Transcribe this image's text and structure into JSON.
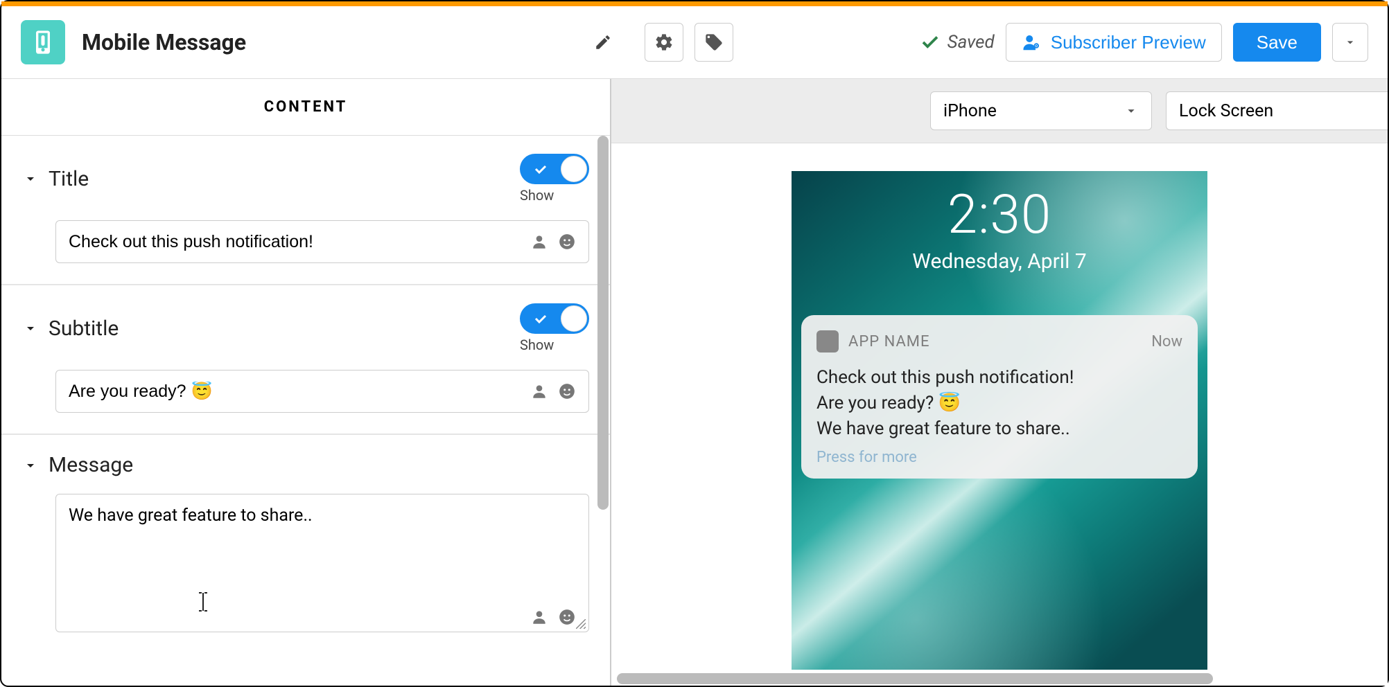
{
  "header": {
    "title": "Mobile Message",
    "saved_label": "Saved",
    "subscriber_preview": "Subscriber Preview",
    "save": "Save"
  },
  "content_tab": "CONTENT",
  "sections": {
    "title": {
      "label": "Title",
      "toggle_label": "Show",
      "value": "Check out this push notification!"
    },
    "subtitle": {
      "label": "Subtitle",
      "toggle_label": "Show",
      "value": "Are you ready? 😇"
    },
    "message": {
      "label": "Message",
      "value": "We have great feature to share.."
    }
  },
  "preview_controls": {
    "device": "iPhone",
    "view": "Lock Screen"
  },
  "phone": {
    "time": "2:30",
    "date": "Wednesday, April 7",
    "app_name": "APP NAME",
    "when": "Now",
    "line1": "Check out this push notification!",
    "line2": "Are you ready? 😇",
    "line3": "We have great feature to share..",
    "more": "Press for more"
  }
}
